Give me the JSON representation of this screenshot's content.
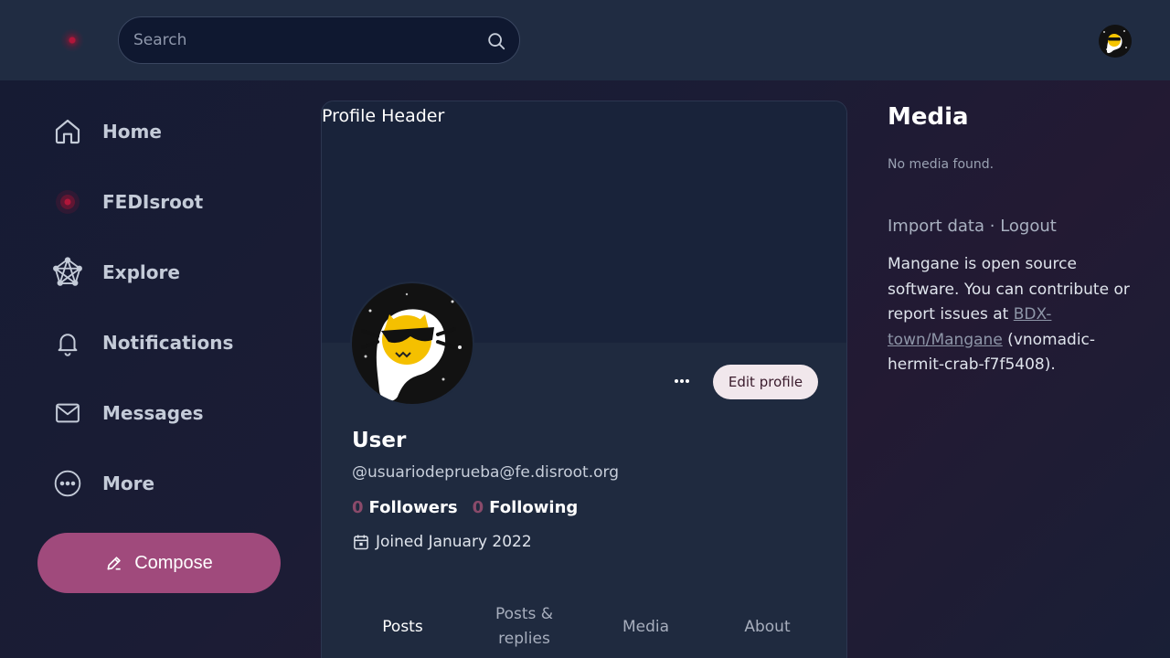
{
  "search": {
    "placeholder": "Search"
  },
  "sidebar": {
    "items": [
      {
        "label": "Home",
        "icon": "home-icon"
      },
      {
        "label": "FEDIsroot",
        "icon": "fedisroot-logo-icon"
      },
      {
        "label": "Explore",
        "icon": "explore-network-icon"
      },
      {
        "label": "Notifications",
        "icon": "bell-icon"
      },
      {
        "label": "Messages",
        "icon": "envelope-icon"
      },
      {
        "label": "More",
        "icon": "ellipsis-circle-icon"
      }
    ],
    "compose_label": "Compose"
  },
  "profile": {
    "header_alt": "Profile Header",
    "display_name": "User",
    "handle": "@usuariodeprueba@fe.disroot.org",
    "followers_count": "0",
    "followers_label": "Followers",
    "following_count": "0",
    "following_label": "Following",
    "joined": "Joined January 2022",
    "more_label": "···",
    "edit_label": "Edit profile",
    "tabs": [
      {
        "label": "Posts",
        "active": true
      },
      {
        "label": "Posts & replies",
        "active": false
      },
      {
        "label": "Media",
        "active": false
      },
      {
        "label": "About",
        "active": false
      }
    ]
  },
  "right": {
    "media_title": "Media",
    "no_media": "No media found.",
    "import_label": "Import data",
    "separator": " · ",
    "logout_label": "Logout",
    "about_prefix": "Mangane is open source software. You can contribute or report issues at ",
    "repo_link": "BDX-town/Mangane",
    "about_suffix": " (vnomadic-hermit-crab-f7f5408)."
  },
  "colors": {
    "accent": "#a04a7c",
    "topbar": "#202c42",
    "card": "#1f2a3f",
    "count": "#8a4a6a"
  }
}
